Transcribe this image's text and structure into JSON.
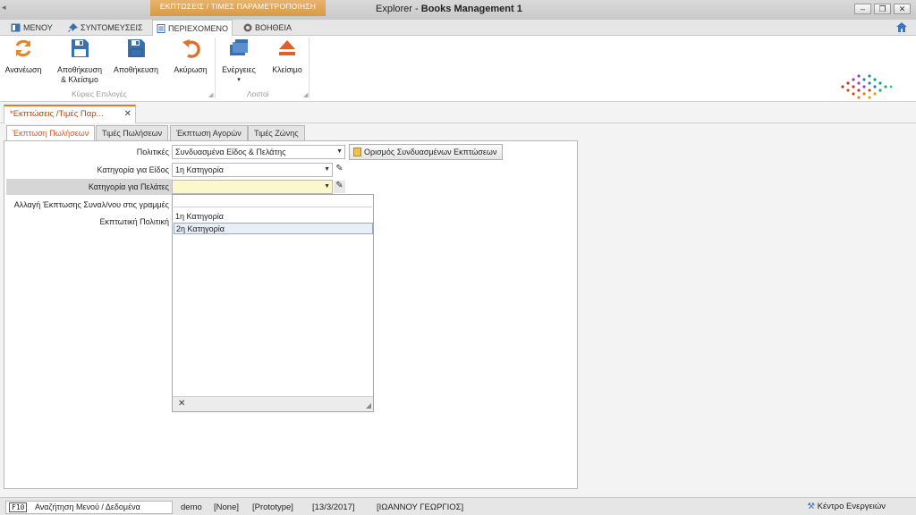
{
  "window": {
    "context_title": "ΕΚΠΤΩΣΕΙΣ / ΤΙΜΕΣ ΠΑΡΑΜΕΤΡΟΠΟΙΗΣΗ",
    "app_name": "Explorer",
    "app_separator": "-",
    "app_module": "Books Management 1",
    "minimize": "–",
    "restore": "❐",
    "close": "✕"
  },
  "ribbon_tabs": [
    {
      "label": "ΜΕΝΟΥ",
      "icon": "menu-book-icon"
    },
    {
      "label": "ΣΥΝΤΟΜΕΥΣΕΙΣ",
      "icon": "pin-icon"
    },
    {
      "label": "ΠΕΡΙΕΧΟΜΕΝΟ",
      "icon": "document-icon",
      "active": true
    },
    {
      "label": "ΒΟΗΘΕΙΑ",
      "icon": "help-icon"
    }
  ],
  "ribbon": {
    "buttons": [
      {
        "label": "Ανανέωση",
        "icon": "refresh-icon"
      },
      {
        "label": "Αποθήκευση",
        "label2": "& Κλείσιμο",
        "icon": "save-close-icon"
      },
      {
        "label": "Αποθήκευση",
        "icon": "save-icon"
      },
      {
        "label": "Ακύρωση",
        "icon": "undo-icon"
      },
      {
        "label": "Ενέργειες",
        "icon": "actions-icon"
      },
      {
        "label": "Κλείσιμο",
        "icon": "eject-icon"
      }
    ],
    "groups": {
      "main": "Κύριες Επιλογές",
      "other": "Λοιποί"
    }
  },
  "document_tab": {
    "label": "*Εκπτώσεις /Τιμές Παρ...",
    "close": "✕"
  },
  "inner_tabs": [
    "Έκπτωση Πωλήσεων",
    "Τιμές Πωλήσεων",
    "Έκπτωση Αγορών",
    "Τιμές Ζώνης"
  ],
  "form": {
    "policies_label": "Πολιτικές",
    "policies_value": "Συνδυασμένα Είδος & Πελάτης",
    "combo_button": "Ορισμός Συνδυασμένων Εκπτώσεων",
    "item_category_label": "Κατηγορία για Είδος",
    "item_category_value": "1η Κατηγορία",
    "customer_category_label": "Κατηγορία για Πελάτες",
    "customer_category_value": "",
    "change_label": "Αλλαγή Έκπτωσης Συναλ/νου στις γραμμές",
    "discount_policy_label": "Εκπτωτική Πολιτική"
  },
  "dropdown": {
    "options": [
      "1η Κατηγορία",
      "2η Κατηγορία"
    ],
    "selected_index": 1,
    "close": "✕"
  },
  "status": {
    "f10_key": "F10",
    "search_label": "Αναζήτηση Μενού / Δεδομένα",
    "user": "demo",
    "none": "[None]",
    "mode": "[Prototype]",
    "date": "[13/3/2017]",
    "name": "[ΙΩΑΝΝΟΥ ΓΕΩΡΓΙΟΣ]",
    "action_center": "Κέντρο Ενεργειών"
  },
  "colors": {
    "accent": "#e8742a",
    "context_title": "#d89a46",
    "ribbon_icon": "#3a6fb0",
    "undo_icon": "#e0702a"
  }
}
